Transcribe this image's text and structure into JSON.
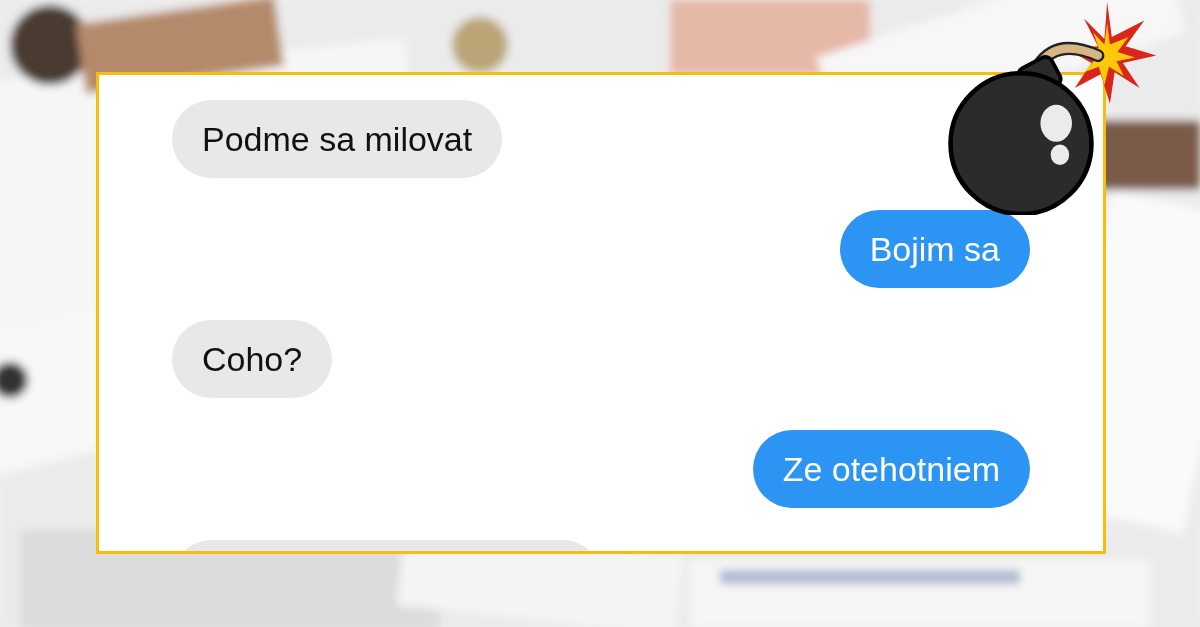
{
  "messages": [
    {
      "kind": "received",
      "text": "Podme sa milovat"
    },
    {
      "kind": "sent",
      "text": "Bojim sa"
    },
    {
      "kind": "received",
      "text": "Coho?"
    },
    {
      "kind": "sent",
      "text": "Ze otehotniem"
    },
    {
      "kind": "received"
    }
  ]
}
